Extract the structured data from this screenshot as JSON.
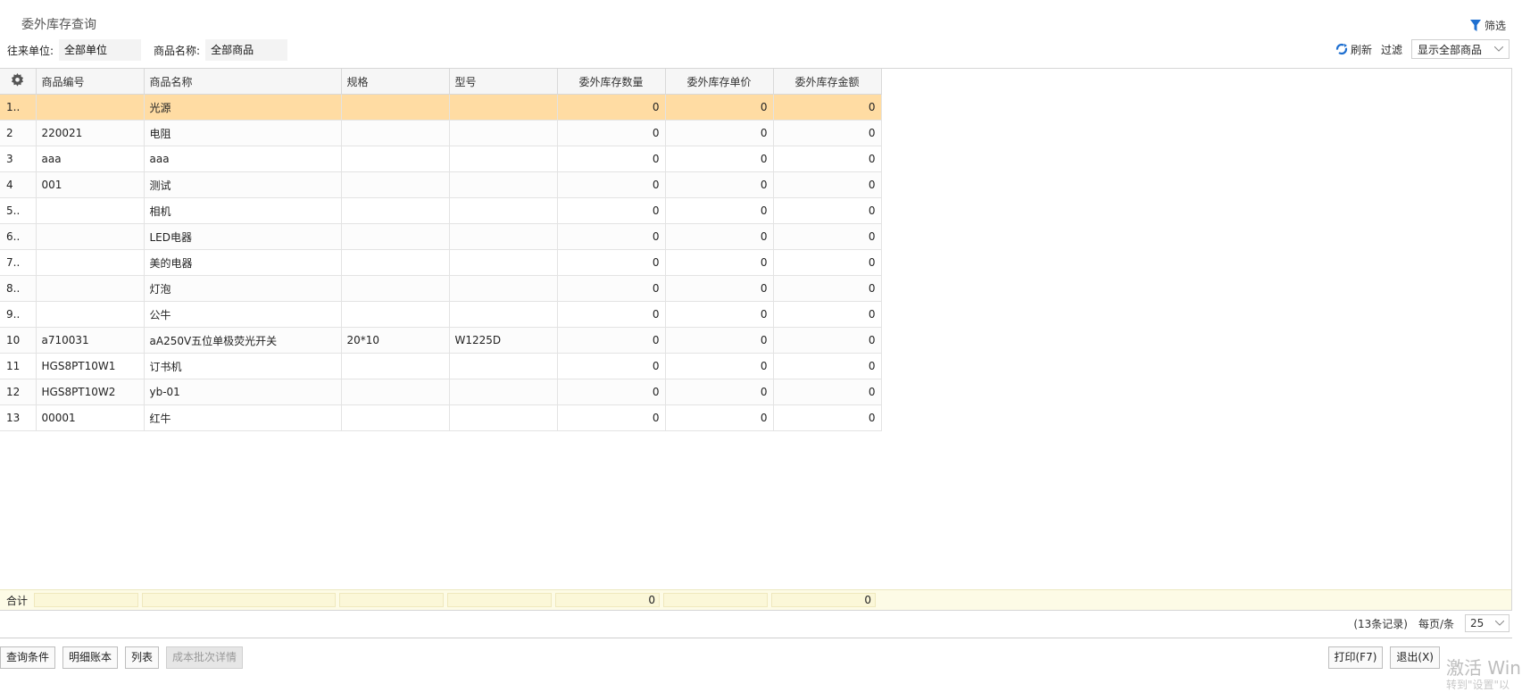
{
  "page": {
    "title": "委外库存查询"
  },
  "toolbar": {
    "filter_label": "筛选",
    "refresh_label": "刷新",
    "filter_text": "过滤",
    "filter_select": "显示全部商品"
  },
  "conditions": {
    "partner_label": "往来单位:",
    "partner_value": "全部单位",
    "goods_label": "商品名称:",
    "goods_value": "全部商品"
  },
  "table": {
    "columns": [
      "商品编号",
      "商品名称",
      "规格",
      "型号",
      "委外库存数量",
      "委外库存单价",
      "委外库存金额"
    ],
    "rows": [
      {
        "idx": "1..",
        "code": "",
        "name": "光源",
        "spec": "",
        "model": "",
        "qty": "0",
        "price": "0",
        "amount": "0"
      },
      {
        "idx": "2",
        "code": "220021",
        "name": "电阻",
        "spec": "",
        "model": "",
        "qty": "0",
        "price": "0",
        "amount": "0"
      },
      {
        "idx": "3",
        "code": "aaa",
        "name": "aaa",
        "spec": "",
        "model": "",
        "qty": "0",
        "price": "0",
        "amount": "0"
      },
      {
        "idx": "4",
        "code": "001",
        "name": "测试",
        "spec": "",
        "model": "",
        "qty": "0",
        "price": "0",
        "amount": "0"
      },
      {
        "idx": "5..",
        "code": "",
        "name": "相机",
        "spec": "",
        "model": "",
        "qty": "0",
        "price": "0",
        "amount": "0"
      },
      {
        "idx": "6..",
        "code": "",
        "name": "LED电器",
        "spec": "",
        "model": "",
        "qty": "0",
        "price": "0",
        "amount": "0"
      },
      {
        "idx": "7..",
        "code": "",
        "name": "美的电器",
        "spec": "",
        "model": "",
        "qty": "0",
        "price": "0",
        "amount": "0"
      },
      {
        "idx": "8..",
        "code": "",
        "name": "灯泡",
        "spec": "",
        "model": "",
        "qty": "0",
        "price": "0",
        "amount": "0"
      },
      {
        "idx": "9..",
        "code": "",
        "name": "公牛",
        "spec": "",
        "model": "",
        "qty": "0",
        "price": "0",
        "amount": "0"
      },
      {
        "idx": "10",
        "code": "a710031",
        "name": "aA250V五位单极荧光开关",
        "spec": "20*10",
        "model": "W1225D",
        "qty": "0",
        "price": "0",
        "amount": "0"
      },
      {
        "idx": "11",
        "code": "HGS8PT10W1",
        "name": "订书机",
        "spec": "",
        "model": "",
        "qty": "0",
        "price": "0",
        "amount": "0"
      },
      {
        "idx": "12",
        "code": "HGS8PT10W2",
        "name": "yb-01",
        "spec": "",
        "model": "",
        "qty": "0",
        "price": "0",
        "amount": "0"
      },
      {
        "idx": "13",
        "code": "00001",
        "name": "红牛",
        "spec": "",
        "model": "",
        "qty": "0",
        "price": "0",
        "amount": "0"
      }
    ]
  },
  "totals": {
    "label": "合计",
    "qty": "0",
    "amount": "0"
  },
  "pager": {
    "records": "(13条记录)",
    "per_page_label": "每页/条",
    "per_page_value": "25"
  },
  "buttons": {
    "query_cond": "查询条件",
    "detail_ledger": "明细账本",
    "list": "列表",
    "cost_batch": "成本批次详情",
    "print": "打印(F7)",
    "exit": "退出(X)"
  },
  "watermark": {
    "line1": "激活 Wind",
    "line2": "转到\"设置\"以"
  },
  "colors": {
    "selected_row": "#ffdca3",
    "total_bg": "#fdfbe6",
    "accent_icon": "#1e6fd0"
  }
}
